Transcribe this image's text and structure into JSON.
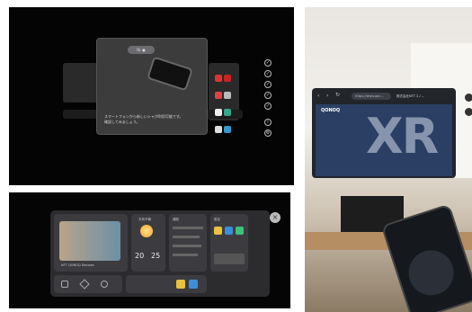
{
  "panel1": {
    "dialog_button_label": "Nr ●",
    "dialog_message": "スマートフォンから新しいシャが利用可能です。\n確認してみましょう。",
    "side_icon_names": [
      "check-circle-icon",
      "check-circle-icon",
      "check-circle-icon",
      "check-circle-icon",
      "check-circle-icon",
      "info-icon",
      "settings-icon"
    ]
  },
  "panel2": {
    "photo_caption": "NTT QONOQ Devices",
    "weather_label": "天気予報",
    "temp_high": "20",
    "temp_low": "25",
    "notifications_label": "通知",
    "settings_label": "設定"
  },
  "panel3": {
    "url": "https://www.qon...",
    "site_title": "株式会社NTTコノ...",
    "site_logo": "QONOQ",
    "hero_text": "XR"
  },
  "colors": {
    "dialog_bg": "#3c3c3c",
    "dashboard_bg": "#2c2c2e",
    "tile_yellow": "#e8c240",
    "tile_blue": "#3c8fd6",
    "tile_green": "#3ec27a"
  }
}
